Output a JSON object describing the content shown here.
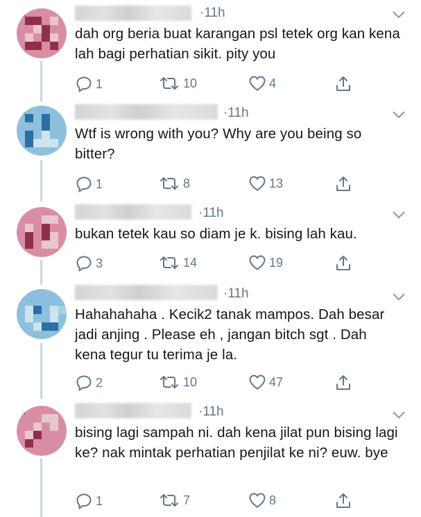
{
  "tweets": [
    {
      "time": "11h",
      "text": "dah org beria buat karangan psl tetek org kan kena lah bagi perhatian sikit. pity you",
      "replies": "1",
      "retweets": "10",
      "likes": "4",
      "avatar": "pink"
    },
    {
      "time": "11h",
      "text": "Wtf is wrong with you? Why are you being so bitter?",
      "replies": "1",
      "retweets": "8",
      "likes": "13",
      "avatar": "blue"
    },
    {
      "time": "11h",
      "text": "bukan tetek kau so diam je k. bising lah kau.",
      "replies": "3",
      "retweets": "14",
      "likes": "19",
      "avatar": "pink"
    },
    {
      "time": "11h",
      "text": "Hahahahaha . Kecik2 tanak mampos. Dah besar jadi anjing . Please eh , jangan bitch sgt . Dah kena tegur tu terima je la.",
      "replies": "2",
      "retweets": "10",
      "likes": "47",
      "avatar": "blue"
    },
    {
      "time": "11h",
      "text": "bising lagi sampah ni. dah kena jilat pun bising lagi ke? nak mintak perhatian penjilat ke ni? euw. bye",
      "replies": "1",
      "retweets": "7",
      "likes": "8",
      "avatar": "pink"
    }
  ],
  "icons": {
    "reply": "reply-icon",
    "retweet": "retweet-icon",
    "like": "heart-icon",
    "share": "share-icon",
    "menu": "chevron-down-icon"
  },
  "colors": {
    "text": "#14171a",
    "muted": "#657786",
    "thread_line": "#ccd6dd"
  }
}
